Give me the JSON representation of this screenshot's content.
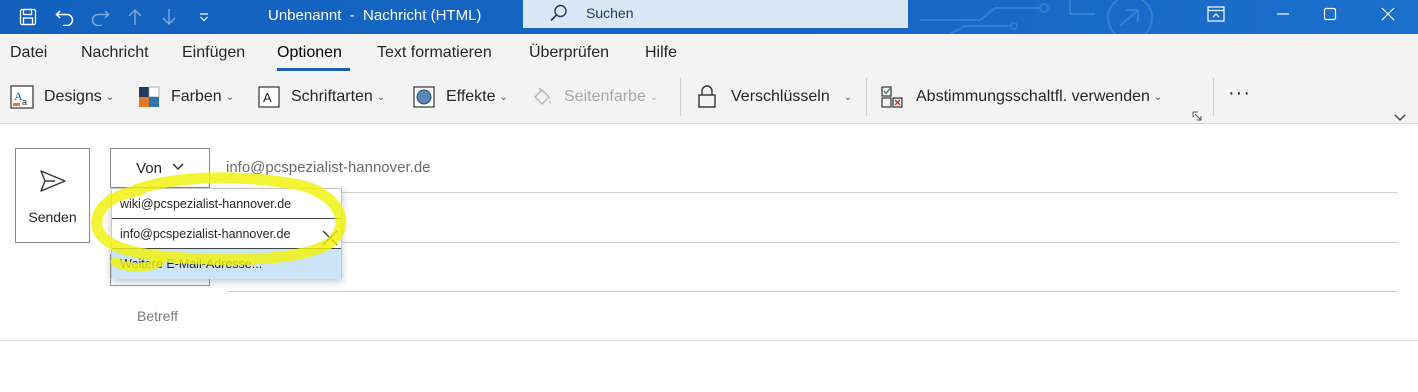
{
  "titlebar": {
    "title": "Unbenannt  -  Nachricht (HTML)",
    "search_label": "Suchen",
    "icons": [
      "save-icon",
      "undo-icon",
      "redo-icon",
      "up-arrow-icon",
      "down-arrow-icon",
      "customize-qat-icon",
      "ribbon-display-icon",
      "minimize-icon",
      "maximize-icon",
      "close-icon"
    ],
    "color": "#1565c0"
  },
  "menu": {
    "items": [
      "Datei",
      "Nachricht",
      "Einfügen",
      "Optionen",
      "Text formatieren",
      "Überprüfen",
      "Hilfe"
    ],
    "active": "Optionen"
  },
  "ribbon": {
    "designs": "Designs",
    "farben": "Farben",
    "schriftarten": "Schriftarten",
    "effekte": "Effekte",
    "seitenfarbe": "Seitenfarbe",
    "verschluesseln": "Verschlüsseln",
    "abstimmung": "Abstimmungsschaltfl. verwenden",
    "more": "···"
  },
  "compose": {
    "send_label": "Senden",
    "from_button": "Von",
    "from_address": "info@pcspezialist-hannover.de",
    "subject_label": "Betreff"
  },
  "from_dropdown": {
    "options": [
      "wiki@pcspezialist-hannover.de",
      "info@pcspezialist-hannover.de",
      "Weitere E-Mail-Adresse..."
    ],
    "highlighted_index": 2,
    "annotation_color": "#f2f20a"
  }
}
